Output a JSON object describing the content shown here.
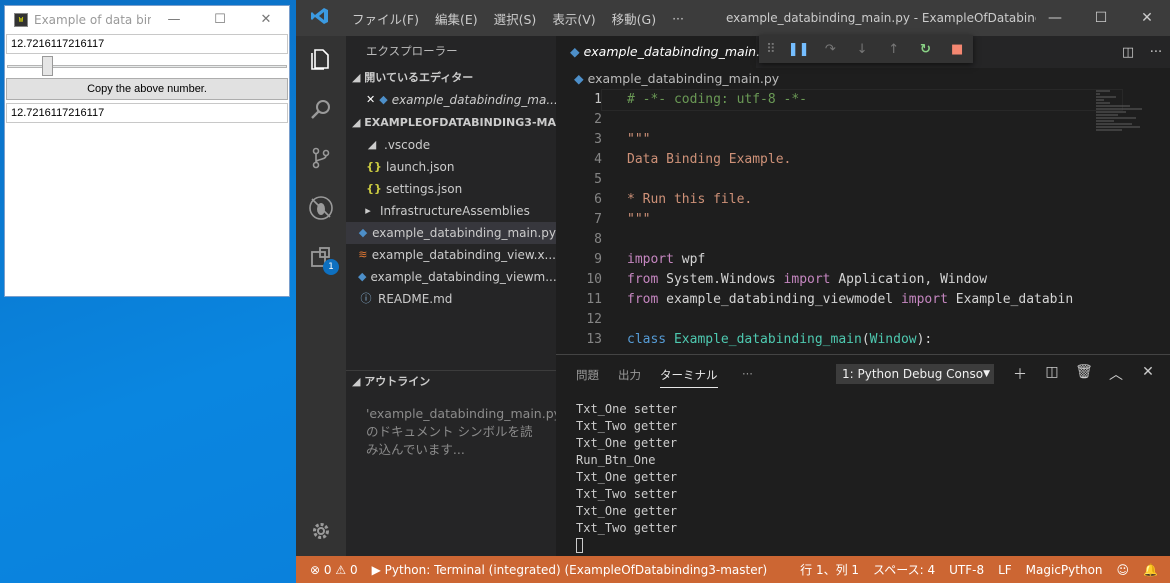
{
  "wpf": {
    "title": "Example of data bin...",
    "text_one": "12.7216117216117",
    "slider_level": 0.13,
    "button_label": "Copy the above number.",
    "text_two": "12.7216117216117"
  },
  "vscode": {
    "menu": [
      "ファイル(F)",
      "編集(E)",
      "選択(S)",
      "表示(V)",
      "移動(G)",
      "···"
    ],
    "window_title": "example_databinding_main.py - ExampleOfDatabindin...",
    "activity_badge": "1",
    "sidebar": {
      "header": "エクスプローラー",
      "open_editors_section": "開いているエディター",
      "open_editor_file": "example_databinding_ma...",
      "project_section": "EXAMPLEOFDATABINDING3-MAS...",
      "tree": [
        {
          "label": ".vscode",
          "icon": "chevron-down-icon"
        },
        {
          "label": "launch.json",
          "icon": "json-icon"
        },
        {
          "label": "settings.json",
          "icon": "json-icon"
        },
        {
          "label": "InfrastructureAssemblies",
          "icon": "chevron-right-icon"
        },
        {
          "label": "example_databinding_main.py",
          "icon": "python-icon"
        },
        {
          "label": "example_databinding_view.x...",
          "icon": "xml-icon"
        },
        {
          "label": "example_databinding_viewm...",
          "icon": "python-icon"
        },
        {
          "label": "README.md",
          "icon": "info-icon"
        }
      ],
      "outline_section": "アウトライン",
      "outline_message": "'example_databinding_main.py' のドキュメント シンボルを読み込んでいます..."
    },
    "tab": "example_databinding_main.py",
    "breadcrumb": "example_databinding_main.py",
    "code": [
      {
        "n": "1",
        "t": "# -*- coding: utf-8 -*-",
        "c": "comment"
      },
      {
        "n": "2",
        "t": "",
        "c": "plain"
      },
      {
        "n": "3",
        "t": "\"\"\"",
        "c": "string"
      },
      {
        "n": "4",
        "t": "Data Binding Example.",
        "c": "string"
      },
      {
        "n": "5",
        "t": "",
        "c": "plain"
      },
      {
        "n": "6",
        "t": "* Run this file.",
        "c": "string"
      },
      {
        "n": "7",
        "t": "\"\"\"",
        "c": "string"
      },
      {
        "n": "8",
        "t": "",
        "c": "plain"
      },
      {
        "n": "9",
        "t": "import wpf",
        "c": "import"
      },
      {
        "n": "10",
        "t": "from System.Windows import Application, Window",
        "c": "import"
      },
      {
        "n": "11",
        "t": "from example_databinding_viewmodel import Example_databin",
        "c": "import"
      },
      {
        "n": "12",
        "t": "",
        "c": "plain"
      },
      {
        "n": "13",
        "t": "class Example_databinding_main(Window):",
        "c": "class"
      }
    ],
    "panel": {
      "tabs": [
        "問題",
        "出力",
        "ターミナル"
      ],
      "active_tab": "ターミナル",
      "more": "···",
      "terminal_select": "1: Python Debug Conso",
      "terminal_lines": [
        "Txt_One setter",
        "Txt_Two getter",
        "Txt_One getter",
        "Run_Btn_One",
        "Txt_One getter",
        "Txt_Two setter",
        "Txt_One getter",
        "Txt_Two getter"
      ]
    },
    "status": {
      "errors": "0",
      "warnings": "0",
      "python_terminal": "Python: Terminal (integrated) (ExampleOfDatabinding3-master)",
      "position": "行 1、列 1",
      "spaces": "スペース: 4",
      "encoding": "UTF-8",
      "eol": "LF",
      "language": "MagicPython"
    },
    "colors": {
      "statusbar": "#cc6633",
      "keyword": "#c586c0",
      "class_name": "#4ec9b0",
      "string": "#ce9178",
      "comment": "#6a9955"
    }
  }
}
